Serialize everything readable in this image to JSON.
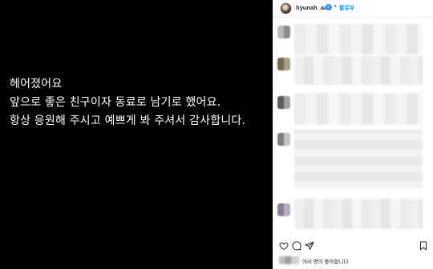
{
  "post": {
    "lines": [
      "헤어졌어요",
      "앞으로 좋은 친구이자 동료로 남기로 했어요.",
      "항상 응원해 주시고 예쁘게 봐 주셔서 감사합니다."
    ]
  },
  "header": {
    "username": "hyunah_aa",
    "verified_glyph": "✓",
    "separator": "•",
    "follow_label": "팔로우"
  },
  "icons": {
    "like": "heart-icon",
    "comment": "comment-icon",
    "share": "share-icon",
    "save": "bookmark-icon"
  },
  "likes": {
    "text": "여러 명이 좋아합니다"
  }
}
